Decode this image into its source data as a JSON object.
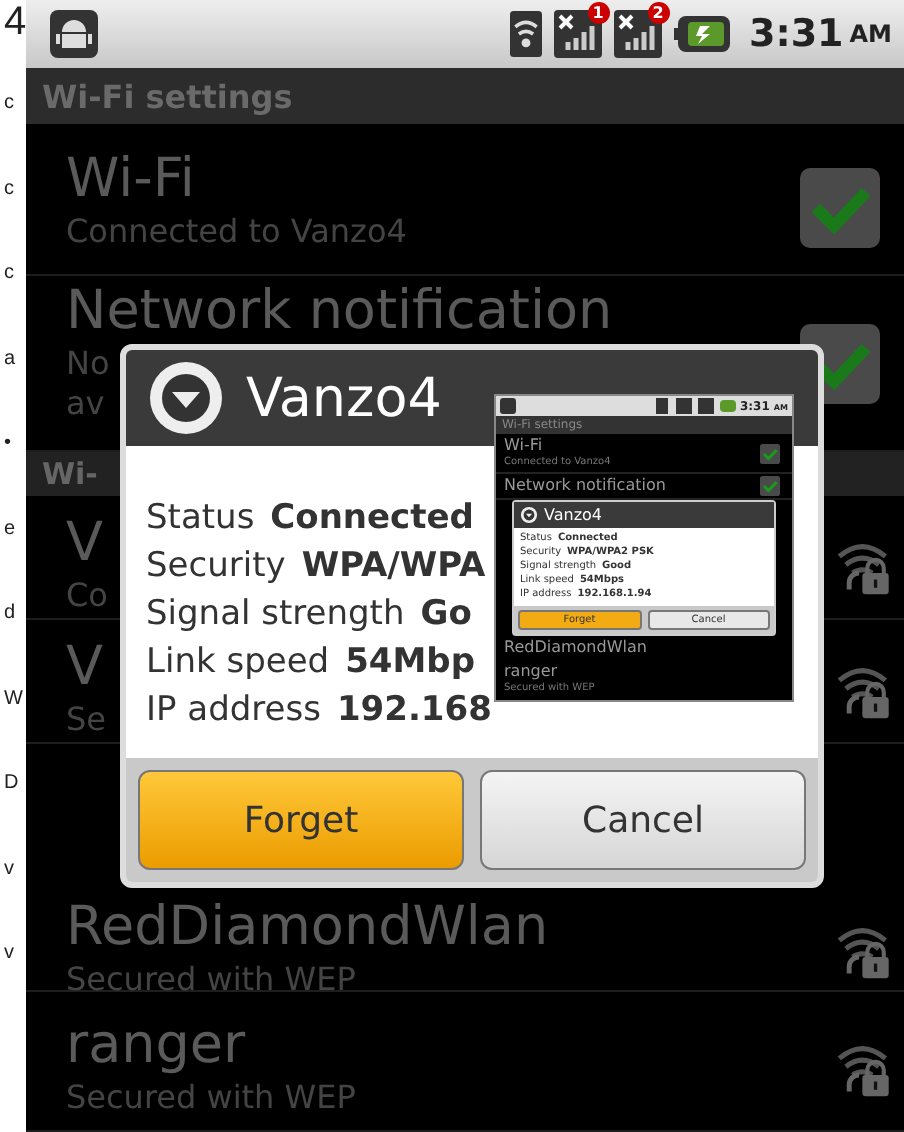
{
  "page_margin": {
    "fragments": [
      "4",
      "c",
      "c",
      "c",
      "a",
      "•",
      "e",
      "d",
      "W",
      "D",
      "v",
      "v"
    ]
  },
  "status_bar": {
    "badges": [
      "1",
      "2"
    ],
    "time": "3:31",
    "meridiem": "AM"
  },
  "title": "Wi-Fi settings",
  "settings": [
    {
      "title": "Wi-Fi",
      "subtitle_lines": [
        "Connected to Vanzo4"
      ],
      "checked": true
    },
    {
      "title": "Network notification",
      "subtitle_lines": [
        "No",
        "av"
      ],
      "checked": true
    }
  ],
  "networks_header": "Wi-",
  "networks": [
    {
      "title": "V",
      "subtitle": "Co"
    },
    {
      "title": "V",
      "subtitle": "Se"
    },
    {
      "title": "RedDiamondWlan",
      "subtitle": "Secured with WEP"
    },
    {
      "title": "ranger",
      "subtitle": "Secured with WEP"
    }
  ],
  "dialog": {
    "title": "Vanzo4",
    "details": [
      {
        "label": "Status",
        "value": "Connected"
      },
      {
        "label": "Security",
        "value": "WPA/WPA"
      },
      {
        "label": "Signal strength",
        "value": "Go"
      },
      {
        "label": "Link speed",
        "value": "54Mbp"
      },
      {
        "label": "IP address",
        "value": "192.168"
      }
    ],
    "buttons": [
      {
        "label": "Forget",
        "kind": "primary"
      },
      {
        "label": "Cancel",
        "kind": "secondary"
      }
    ]
  },
  "inset_screenshot": {
    "time": "3:31",
    "meridiem": "AM",
    "title": "Wi-Fi settings",
    "settings": [
      {
        "title": "Wi-Fi",
        "subtitle": "Connected to Vanzo4",
        "checked": true
      },
      {
        "title": "Network notification",
        "checked": true
      }
    ],
    "dialog": {
      "title": "Vanzo4",
      "details": [
        {
          "label": "Status",
          "value": "Connected"
        },
        {
          "label": "Security",
          "value": "WPA/WPA2 PSK"
        },
        {
          "label": "Signal strength",
          "value": "Good"
        },
        {
          "label": "Link speed",
          "value": "54Mbps"
        },
        {
          "label": "IP address",
          "value": "192.168.1.94"
        }
      ],
      "buttons": [
        {
          "label": "Forget",
          "kind": "primary"
        },
        {
          "label": "Cancel",
          "kind": "secondary"
        }
      ]
    },
    "networks": [
      {
        "title": "RedDiamondWlan"
      },
      {
        "title": "ranger",
        "subtitle": "Secured with WEP"
      }
    ]
  }
}
